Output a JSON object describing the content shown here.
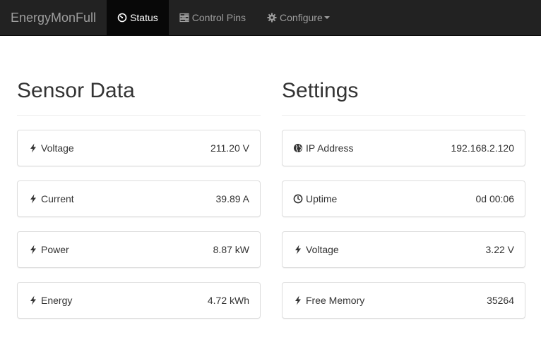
{
  "navbar": {
    "brand": "EnergyMonFull",
    "items": [
      {
        "label": "Status",
        "icon": "dashboard-icon",
        "active": true
      },
      {
        "label": "Control Pins",
        "icon": "tasks-icon",
        "active": false
      },
      {
        "label": "Configure",
        "icon": "cog-icon",
        "active": false,
        "dropdown": true
      }
    ]
  },
  "sensor": {
    "title": "Sensor Data",
    "cards": [
      {
        "label": "Voltage",
        "value": "211.20 V",
        "icon": "flash-icon"
      },
      {
        "label": "Current",
        "value": "39.89 A",
        "icon": "flash-icon"
      },
      {
        "label": "Power",
        "value": "8.87 kW",
        "icon": "flash-icon"
      },
      {
        "label": "Energy",
        "value": "4.72 kWh",
        "icon": "flash-icon"
      }
    ]
  },
  "settings": {
    "title": "Settings",
    "cards": [
      {
        "label": "IP Address",
        "value": "192.168.2.120",
        "icon": "globe-icon"
      },
      {
        "label": "Uptime",
        "value": "0d 00:06",
        "icon": "clock-icon"
      },
      {
        "label": "Voltage",
        "value": "3.22 V",
        "icon": "flash-icon"
      },
      {
        "label": "Free Memory",
        "value": "35264",
        "icon": "flash-icon"
      }
    ]
  }
}
